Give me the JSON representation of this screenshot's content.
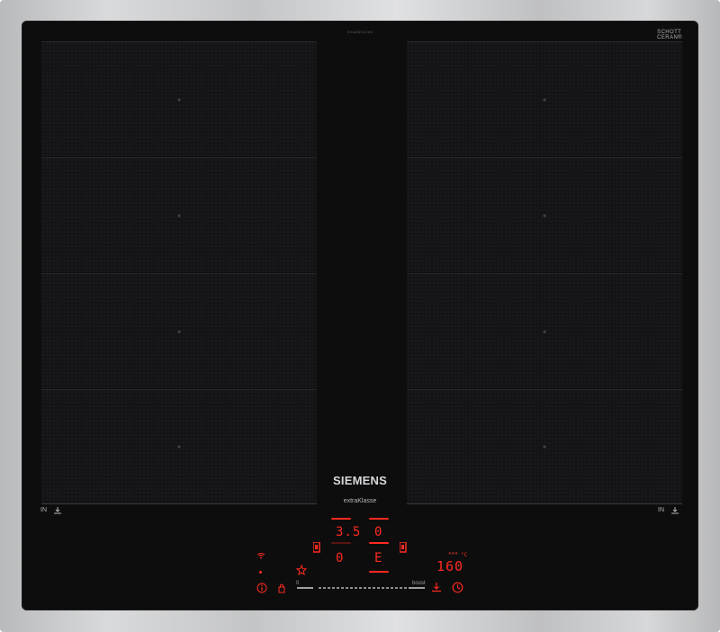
{
  "hob": {
    "model_code": "EX645HXC1M",
    "glass_brand_line1": "SCHOTT",
    "glass_brand_line2": "CERAN®",
    "brand": "SIEMENS",
    "series": "extraKlasse",
    "left_zone_label": "IN",
    "right_zone_label": "IN",
    "zone_icon": "pan-arrow-icon"
  },
  "controls": {
    "zone_display_top_left": "3.5",
    "zone_display_top_right": "0",
    "zone_display_bottom_left": "0",
    "zone_display_bottom_right": "E",
    "temperature_value": "160",
    "temperature_unit": "°C",
    "slider_min_label": "0",
    "slider_max_label": "boost",
    "icons": [
      "wifi-icon",
      "star-icon",
      "info-icon",
      "lock-icon",
      "pan-arrow-icon",
      "clock-icon"
    ]
  },
  "colors": {
    "led": "#ff2a1f",
    "glass": "#0d0d0e",
    "frame": "#c8c9ca"
  }
}
